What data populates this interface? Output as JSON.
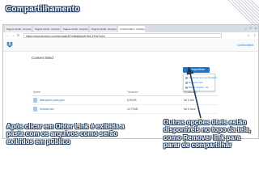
{
  "slide": {
    "title": "Compartilhamento",
    "callout_left": "Após clicar em Obter Link é exibida a pasta com os arquivos como serão exibidos em público",
    "callout_right": "Outras opções úteis estão disponíveis no topo da tela, como Remover link para parar de compartilhar"
  },
  "browser": {
    "tabs": [
      {
        "label": "Pagina Inicial - Dropbox",
        "active": false
      },
      {
        "label": "Pagina Inicial - Dropbox",
        "active": false
      },
      {
        "label": "Pagina Inicial - Dropbox",
        "active": false
      },
      {
        "label": "Pagina Inicial - Dropbox",
        "active": false
      },
      {
        "label": "Content Mind - Dropbox",
        "active": true
      }
    ],
    "url": "https://www.dropbox.com/sh/yqgkr5j7mlkfa8a/AACfk4-5Ybz7n/en"
  },
  "dropbox": {
    "folder_title": "Content Mind",
    "share_label": "Compartilhar",
    "user_label": "Content Mind",
    "menu_items": [
      "Adicionar ao meu Dropbox",
      "Remover link",
      "Baixar arquivo .zip"
    ],
    "columns": [
      "Nome",
      "Tamanho",
      "Modificado"
    ],
    "rows": [
      {
        "name": "alterações para.pptx",
        "size": "8,99 kB",
        "modified": "há 1 min"
      },
      {
        "name": "Intranet.doc",
        "size": "12,79 kB",
        "modified": "há 1 hora"
      }
    ]
  },
  "colors": {
    "accent": "#1f75cb",
    "title_outline": "#1f3a5a"
  }
}
